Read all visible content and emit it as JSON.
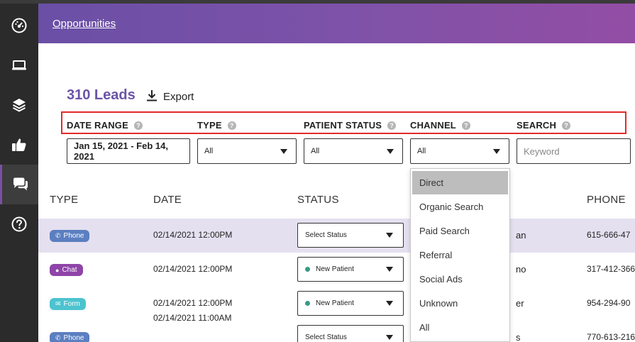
{
  "header": {
    "breadcrumb": "Opportunities"
  },
  "sidebar": {
    "items": [
      {
        "icon": "dashboard-icon"
      },
      {
        "icon": "laptop-icon"
      },
      {
        "icon": "layers-icon"
      },
      {
        "icon": "thumbs-up-icon"
      },
      {
        "icon": "chat-icon",
        "active": true
      },
      {
        "icon": "help-icon"
      }
    ]
  },
  "summary": {
    "leads": "310 Leads",
    "export_label": "Export"
  },
  "filters": {
    "date_range_label": "DATE RANGE",
    "type_label": "TYPE",
    "patient_status_label": "PATIENT STATUS",
    "channel_label": "CHANNEL",
    "search_label": "SEARCH",
    "help_glyph": "?",
    "date_range_value": "Jan 15, 2021 - Feb 14, 2021",
    "type_value": "All",
    "patient_status_value": "All",
    "channel_value": "All",
    "search_placeholder": "Keyword"
  },
  "table": {
    "columns": {
      "type": "TYPE",
      "date": "DATE",
      "status": "STATUS",
      "phone": "PHONE"
    },
    "rows": [
      {
        "type": "Phone",
        "type_icon": "phone-icon",
        "type_color": "#5b7fc0",
        "date": "02/14/2021 12:00PM",
        "status": "Select Status",
        "name_fragment": "an",
        "phone": "615-666-47"
      },
      {
        "type": "Chat",
        "type_icon": "chat-bubble-icon",
        "type_color": "#8e44a8",
        "date": "02/14/2021 12:00PM",
        "status": "New Patient",
        "name_fragment": "no",
        "phone": "317-412-366"
      },
      {
        "type": "Form",
        "type_icon": "envelope-icon",
        "type_color": "#4cc3cf",
        "date": "02/14/2021 12:00PM",
        "status": "New Patient",
        "name_fragment": "er",
        "phone": "954-294-90"
      },
      {
        "type": "Phone",
        "type_icon": "phone-icon",
        "type_color": "#5b7fc0",
        "date": "02/14/2021 11:00AM",
        "status": "Select Status",
        "name_fragment": "s",
        "phone": "770-613-216"
      }
    ]
  },
  "channel_dropdown": {
    "options": [
      "Direct",
      "Organic Search",
      "Paid Search",
      "Referral",
      "Social Ads",
      "Unknown",
      "All"
    ],
    "highlighted": "Direct"
  },
  "colors": {
    "accent": "#6b53a6",
    "highlight_border": "#e22a2a",
    "row_highlight": "#e5e0f0",
    "status_dot": "#3a9a86"
  }
}
